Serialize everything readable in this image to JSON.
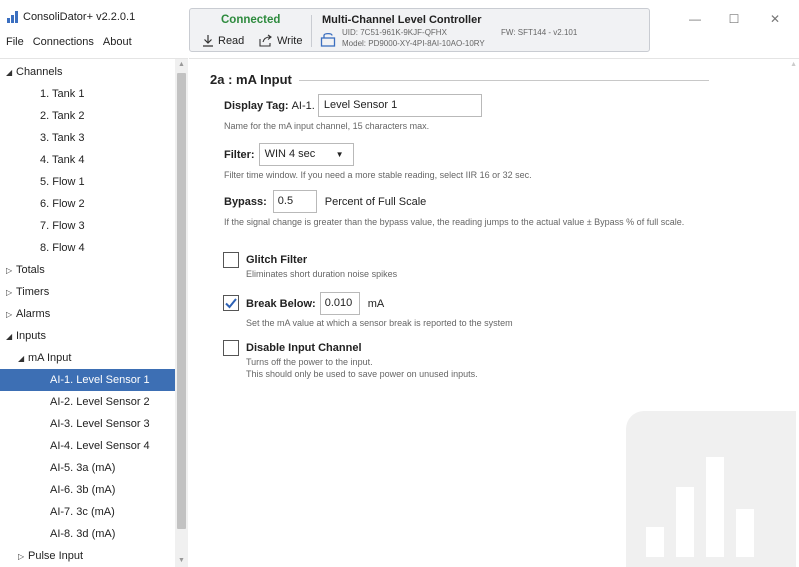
{
  "app": {
    "title": "ConsoliDator+ v2.2.0.1",
    "logo_icon": "bar-chart-icon",
    "accent": "#3b6fc0"
  },
  "menu": [
    "File",
    "Connections",
    "About"
  ],
  "connection": {
    "status": "Connected",
    "status_color": "#2e8b3e",
    "read_label": "Read",
    "write_label": "Write",
    "device_title": "Multi-Channel Level Controller",
    "uid": "UID: 7C51-961K-9KJF-QFHX",
    "fw": "FW: SFT144 - v2.101",
    "model": "Model: PD9000-XY-4PI-8AI-10AO-10RY"
  },
  "window_controls": [
    "minimize",
    "maximize",
    "close"
  ],
  "sidebar": {
    "items": [
      {
        "label": "Channels",
        "arrow": "◢",
        "level": 0
      },
      {
        "label": "1. Tank 1",
        "level": 2
      },
      {
        "label": "2. Tank 2",
        "level": 2
      },
      {
        "label": "3. Tank  3",
        "level": 2
      },
      {
        "label": "4. Tank 4",
        "level": 2
      },
      {
        "label": "5. Flow 1",
        "level": 2
      },
      {
        "label": "6. Flow 2",
        "level": 2
      },
      {
        "label": "7. Flow 3",
        "level": 2
      },
      {
        "label": "8. Flow 4",
        "level": 2
      },
      {
        "label": "Totals",
        "arrow": "▷",
        "level": 0
      },
      {
        "label": "Timers",
        "arrow": "▷",
        "level": 0
      },
      {
        "label": "Alarms",
        "arrow": "▷",
        "level": 0
      },
      {
        "label": "Inputs",
        "arrow": "◢",
        "level": 0
      },
      {
        "label": "mA Input",
        "arrow": "◢",
        "level": 1
      },
      {
        "label": "AI-1. Level Sensor 1",
        "level": 3,
        "selected": true
      },
      {
        "label": "AI-2. Level Sensor 2",
        "level": 3
      },
      {
        "label": "AI-3. Level Sensor 3",
        "level": 3
      },
      {
        "label": "AI-4. Level Sensor 4",
        "level": 3
      },
      {
        "label": "AI-5. 3a (mA)",
        "level": 3
      },
      {
        "label": "AI-6. 3b (mA)",
        "level": 3
      },
      {
        "label": "AI-7. 3c (mA)",
        "level": 3
      },
      {
        "label": "AI-8. 3d (mA)",
        "level": 3
      },
      {
        "label": "Pulse Input",
        "arrow": "▷",
        "level": 1
      }
    ],
    "selected_color": "#3d6fb4"
  },
  "main": {
    "title": "2a : mA Input",
    "display_tag": {
      "label": "Display Tag:",
      "prefix": "AI-1.",
      "value": "Level Sensor 1",
      "help": "Name for the mA input channel, 15 characters max."
    },
    "filter": {
      "label": "Filter:",
      "value": "WIN 4 sec",
      "help": "Filter time window. If you need a more stable reading, select IIR 16 or 32 sec."
    },
    "bypass": {
      "label": "Bypass:",
      "value": "0.5",
      "unit": "Percent of Full Scale",
      "help": "If the signal change is greater than the bypass value, the reading jumps to the actual value ± Bypass % of full scale."
    },
    "glitch_filter": {
      "label": "Glitch Filter",
      "checked": false,
      "help": "Eliminates short duration noise spikes"
    },
    "break_below": {
      "label": "Break Below:",
      "checked": true,
      "value": "0.010",
      "unit": "mA",
      "help": "Set the mA value at which a sensor break is reported to the system"
    },
    "disable_channel": {
      "label": "Disable Input Channel",
      "checked": false,
      "help_line1": "Turns off the power to the input.",
      "help_line2": "This should only be used to save power on unused inputs."
    }
  }
}
